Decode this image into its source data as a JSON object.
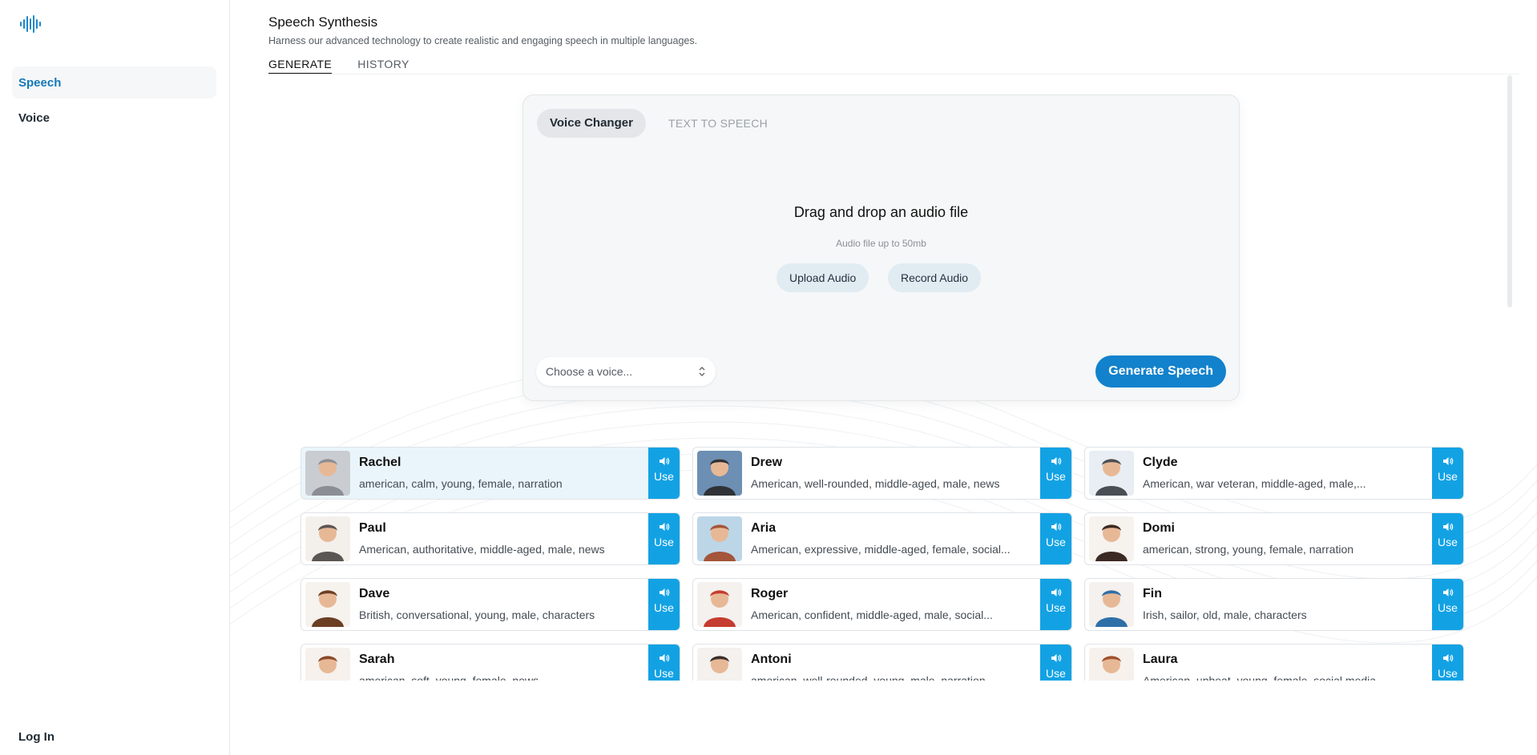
{
  "sidebar": {
    "items": [
      {
        "label": "Speech",
        "active": true
      },
      {
        "label": "Voice",
        "active": false
      }
    ],
    "login_label": "Log In"
  },
  "header": {
    "title": "Speech Synthesis",
    "subtitle": "Harness our advanced technology to create realistic and engaging speech in multiple languages.",
    "tabs": [
      {
        "label": "GENERATE",
        "active": true
      },
      {
        "label": "HISTORY",
        "active": false
      }
    ]
  },
  "card": {
    "segments": [
      {
        "label": "Voice Changer",
        "active": true
      },
      {
        "label": "TEXT TO SPEECH",
        "active": false
      }
    ],
    "drop_title": "Drag and drop an audio file",
    "drop_subtitle": "Audio file up to 50mb",
    "upload_label": "Upload Audio",
    "record_label": "Record Audio",
    "voice_select_placeholder": "Choose a voice...",
    "generate_label": "Generate Speech"
  },
  "voices": [
    {
      "name": "Rachel",
      "desc": "american, calm, young, female, narration",
      "selected": true
    },
    {
      "name": "Drew",
      "desc": "American, well-rounded, middle-aged, male, news"
    },
    {
      "name": "Clyde",
      "desc": "American, war veteran, middle-aged, male,..."
    },
    {
      "name": "Paul",
      "desc": "American, authoritative, middle-aged, male, news"
    },
    {
      "name": "Aria",
      "desc": "American, expressive, middle-aged, female, social..."
    },
    {
      "name": "Domi",
      "desc": "american, strong, young, female, narration"
    },
    {
      "name": "Dave",
      "desc": "British, conversational, young, male, characters"
    },
    {
      "name": "Roger",
      "desc": "American, confident, middle-aged, male, social..."
    },
    {
      "name": "Fin",
      "desc": "Irish, sailor, old, male, characters"
    },
    {
      "name": "Sarah",
      "desc": "american, soft, young, female, news"
    },
    {
      "name": "Antoni",
      "desc": "american, well-rounded, young, male, narration"
    },
    {
      "name": "Laura",
      "desc": "American, upbeat, young, female, social media"
    }
  ],
  "use_label": "Use",
  "colors": {
    "accent": "#1282cc",
    "use_button": "#12a2e4",
    "active_nav": "#1479b8"
  }
}
